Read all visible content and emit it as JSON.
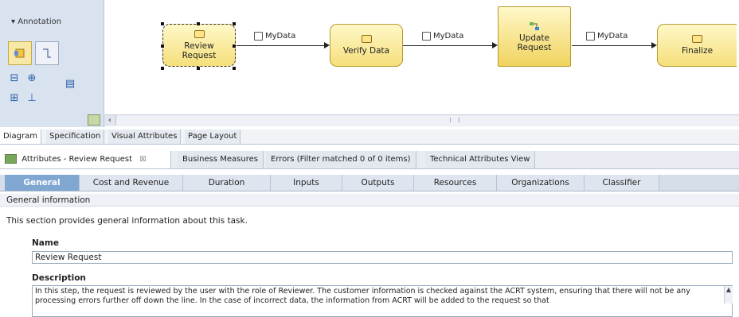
{
  "palette": {
    "title": "Annotation"
  },
  "diagram": {
    "tasks": [
      {
        "label": "Review\nRequest"
      },
      {
        "label": "Verify Data"
      },
      {
        "label": "Update\nRequest"
      },
      {
        "label": "Finalize"
      }
    ],
    "connector_label": "MyData"
  },
  "editor_tabs": [
    "Diagram",
    "Specification",
    "Visual Attributes",
    "Page Layout"
  ],
  "properties": {
    "tabs": [
      "Attributes - Review Request",
      "Business Measures",
      "Errors (Filter matched 0 of 0 items)",
      "Technical Attributes View"
    ],
    "close_glyph": "☒",
    "sub_tabs": [
      "General",
      "Cost and Revenue",
      "Duration",
      "Inputs",
      "Outputs",
      "Resources",
      "Organizations",
      "Classifier"
    ],
    "section_header": "General information",
    "section_desc": "This section provides general information about this task.",
    "name_label": "Name",
    "name_value": "Review Request",
    "description_label": "Description",
    "description_value": "In this step, the request is reviewed by the user with the role of Reviewer.  The customer information is checked against the ACRT system, ensuring that there will not be any processing errors further off down the line.  In the case of incorrect data, the information from ACRT will be added to the request so that"
  },
  "icons": {
    "arrow_left": "‹",
    "scroll_up": "▲"
  }
}
